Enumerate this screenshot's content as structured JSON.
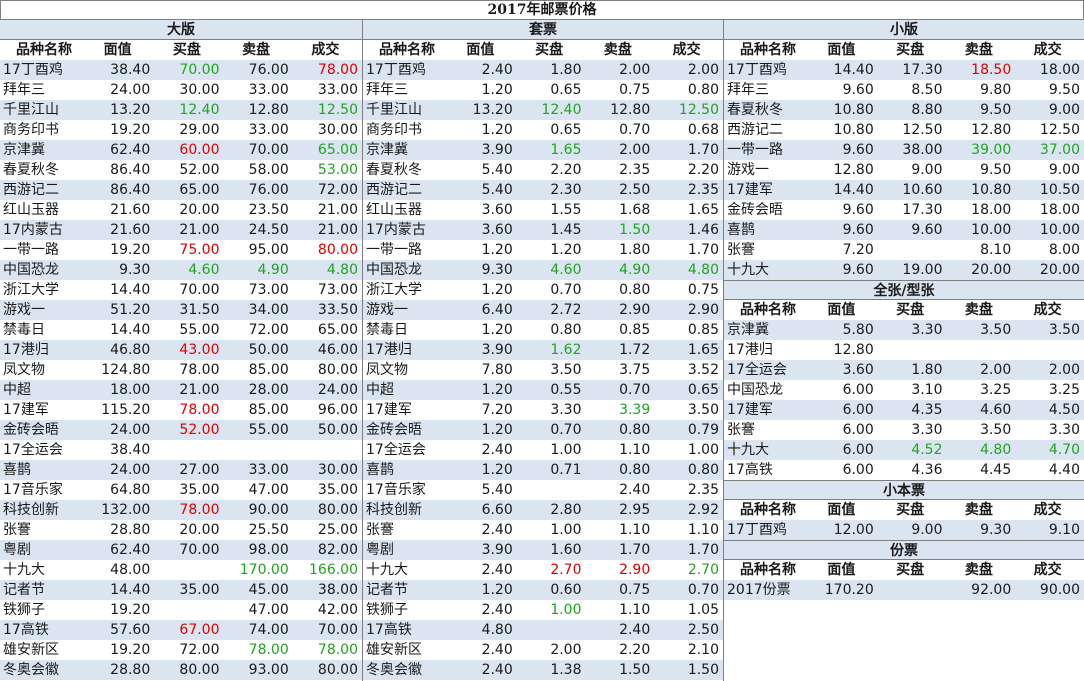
{
  "title": "2017年邮票价格",
  "headers": [
    "品种名称",
    "面值",
    "买盘",
    "卖盘",
    "成交"
  ],
  "sections": {
    "daban": {
      "title": "大版",
      "rows": [
        [
          "17丁酉鸡",
          "38.40",
          "70.00",
          "76.00",
          "78.00"
        ],
        [
          "拜年三",
          "24.00",
          "30.00",
          "33.00",
          "33.00"
        ],
        [
          "千里江山",
          "13.20",
          "12.40",
          "12.80",
          "12.50"
        ],
        [
          "商务印书",
          "19.20",
          "29.00",
          "33.00",
          "30.00"
        ],
        [
          "京津冀",
          "62.40",
          "60.00",
          "70.00",
          "65.00"
        ],
        [
          "春夏秋冬",
          "86.40",
          "52.00",
          "58.00",
          "53.00"
        ],
        [
          "西游记二",
          "86.40",
          "65.00",
          "76.00",
          "72.00"
        ],
        [
          "红山玉器",
          "21.60",
          "20.00",
          "23.50",
          "21.00"
        ],
        [
          "17内蒙古",
          "21.60",
          "21.00",
          "24.50",
          "21.00"
        ],
        [
          "一带一路",
          "19.20",
          "75.00",
          "95.00",
          "80.00"
        ],
        [
          "中国恐龙",
          "9.30",
          "4.60",
          "4.90",
          "4.80"
        ],
        [
          "浙江大学",
          "14.40",
          "70.00",
          "73.00",
          "73.00"
        ],
        [
          "游戏一",
          "51.20",
          "31.50",
          "34.00",
          "33.50"
        ],
        [
          "禁毒日",
          "14.40",
          "55.00",
          "72.00",
          "65.00"
        ],
        [
          "17港归",
          "46.80",
          "43.00",
          "50.00",
          "46.00"
        ],
        [
          "凤文物",
          "124.80",
          "78.00",
          "85.00",
          "80.00"
        ],
        [
          "中超",
          "18.00",
          "21.00",
          "28.00",
          "24.00"
        ],
        [
          "17建军",
          "115.20",
          "78.00",
          "85.00",
          "96.00"
        ],
        [
          "金砖会晤",
          "24.00",
          "52.00",
          "55.00",
          "50.00"
        ],
        [
          "17全运会",
          "38.40",
          "",
          "",
          ""
        ],
        [
          "喜鹊",
          "24.00",
          "27.00",
          "33.00",
          "30.00"
        ],
        [
          "17音乐家",
          "64.80",
          "35.00",
          "47.00",
          "35.00"
        ],
        [
          "科技创新",
          "132.00",
          "78.00",
          "90.00",
          "80.00"
        ],
        [
          "张謇",
          "28.80",
          "20.00",
          "25.50",
          "25.00"
        ],
        [
          "粤剧",
          "62.40",
          "70.00",
          "98.00",
          "82.00"
        ],
        [
          "十九大",
          "48.00",
          "",
          "170.00",
          "166.00"
        ],
        [
          "记者节",
          "14.40",
          "35.00",
          "45.00",
          "38.00"
        ],
        [
          "铁狮子",
          "19.20",
          "",
          "47.00",
          "42.00"
        ],
        [
          "17高铁",
          "57.60",
          "67.00",
          "74.00",
          "70.00"
        ],
        [
          "雄安新区",
          "19.20",
          "72.00",
          "78.00",
          "78.00"
        ],
        [
          "冬奥会徽",
          "28.80",
          "80.00",
          "93.00",
          "80.00"
        ]
      ]
    },
    "taopiao": {
      "title": "套票",
      "rows": [
        [
          "17丁酉鸡",
          "2.40",
          "1.80",
          "2.00",
          "2.00"
        ],
        [
          "拜年三",
          "1.20",
          "0.65",
          "0.75",
          "0.80"
        ],
        [
          "千里江山",
          "13.20",
          "12.40",
          "12.80",
          "12.50"
        ],
        [
          "商务印书",
          "1.20",
          "0.65",
          "0.70",
          "0.68"
        ],
        [
          "京津冀",
          "3.90",
          "1.65",
          "2.00",
          "1.70"
        ],
        [
          "春夏秋冬",
          "5.40",
          "2.20",
          "2.35",
          "2.20"
        ],
        [
          "西游记二",
          "5.40",
          "2.30",
          "2.50",
          "2.35"
        ],
        [
          "红山玉器",
          "3.60",
          "1.55",
          "1.68",
          "1.65"
        ],
        [
          "17内蒙古",
          "3.60",
          "1.45",
          "1.50",
          "1.46"
        ],
        [
          "一带一路",
          "1.20",
          "1.20",
          "1.80",
          "1.70"
        ],
        [
          "中国恐龙",
          "9.30",
          "4.60",
          "4.90",
          "4.80"
        ],
        [
          "浙江大学",
          "1.20",
          "0.70",
          "0.80",
          "0.75"
        ],
        [
          "游戏一",
          "6.40",
          "2.72",
          "2.90",
          "2.90"
        ],
        [
          "禁毒日",
          "1.20",
          "0.80",
          "0.85",
          "0.85"
        ],
        [
          "17港归",
          "3.90",
          "1.62",
          "1.72",
          "1.65"
        ],
        [
          "凤文物",
          "7.80",
          "3.50",
          "3.75",
          "3.52"
        ],
        [
          "中超",
          "1.20",
          "0.55",
          "0.70",
          "0.65"
        ],
        [
          "17建军",
          "7.20",
          "3.30",
          "3.39",
          "3.50"
        ],
        [
          "金砖会晤",
          "1.20",
          "0.70",
          "0.80",
          "0.79"
        ],
        [
          "17全运会",
          "2.40",
          "1.00",
          "1.10",
          "1.00"
        ],
        [
          "喜鹊",
          "1.20",
          "0.71",
          "0.80",
          "0.80"
        ],
        [
          "17音乐家",
          "5.40",
          "",
          "2.40",
          "2.35"
        ],
        [
          "科技创新",
          "6.60",
          "2.80",
          "2.95",
          "2.92"
        ],
        [
          "张謇",
          "2.40",
          "1.00",
          "1.10",
          "1.10"
        ],
        [
          "粤剧",
          "3.90",
          "1.60",
          "1.70",
          "1.70"
        ],
        [
          "十九大",
          "2.40",
          "2.70",
          "2.90",
          "2.70"
        ],
        [
          "记者节",
          "1.20",
          "0.60",
          "0.75",
          "0.70"
        ],
        [
          "铁狮子",
          "2.40",
          "1.00",
          "1.10",
          "1.05"
        ],
        [
          "17高铁",
          "4.80",
          "",
          "2.40",
          "2.50"
        ],
        [
          "雄安新区",
          "2.40",
          "2.00",
          "2.20",
          "2.10"
        ],
        [
          "冬奥会徽",
          "2.40",
          "1.38",
          "1.50",
          "1.50"
        ]
      ]
    },
    "xiaoban": {
      "title": "小版",
      "rows": [
        [
          "17丁酉鸡",
          "14.40",
          "17.30",
          "18.50",
          "18.00"
        ],
        [
          "拜年三",
          "9.60",
          "8.50",
          "9.80",
          "9.50"
        ],
        [
          "春夏秋冬",
          "10.80",
          "8.80",
          "9.50",
          "9.00"
        ],
        [
          "西游记二",
          "10.80",
          "12.50",
          "12.80",
          "12.50"
        ],
        [
          "一带一路",
          "9.60",
          "38.00",
          "39.00",
          "37.00"
        ],
        [
          "游戏一",
          "12.80",
          "9.00",
          "9.50",
          "9.00"
        ],
        [
          "17建军",
          "14.40",
          "10.60",
          "10.80",
          "10.50"
        ],
        [
          "金砖会晤",
          "9.60",
          "17.30",
          "18.00",
          "18.00"
        ],
        [
          "喜鹊",
          "9.60",
          "9.60",
          "10.00",
          "10.00"
        ],
        [
          "张謇",
          "7.20",
          "",
          "8.10",
          "8.00"
        ],
        [
          "十九大",
          "9.60",
          "19.00",
          "20.00",
          "20.00"
        ]
      ]
    },
    "quanzhang": {
      "title": "全张/型张",
      "rows": [
        [
          "京津冀",
          "5.80",
          "3.30",
          "3.50",
          "3.50"
        ],
        [
          "17港归",
          "12.80",
          "",
          "",
          ""
        ],
        [
          "17全运会",
          "3.60",
          "1.80",
          "2.00",
          "2.00"
        ],
        [
          "中国恐龙",
          "6.00",
          "3.10",
          "3.25",
          "3.25"
        ],
        [
          "17建军",
          "6.00",
          "4.35",
          "4.60",
          "4.50"
        ],
        [
          "张謇",
          "6.00",
          "3.30",
          "3.50",
          "3.30"
        ],
        [
          "十九大",
          "6.00",
          "4.52",
          "4.80",
          "4.70"
        ],
        [
          "17高铁",
          "6.00",
          "4.36",
          "4.45",
          "4.40"
        ]
      ]
    },
    "xiaobenpiao": {
      "title": "小本票",
      "rows": [
        [
          "17丁酉鸡",
          "12.00",
          "9.00",
          "9.30",
          "9.10"
        ]
      ]
    },
    "fenpiao": {
      "title": "份票",
      "rows": [
        [
          "2017份票",
          "170.20",
          "",
          "92.00",
          "90.00"
        ]
      ]
    }
  },
  "colors": {
    "up": "#e00000",
    "down": "#1fa51f",
    "stripe": "#dbe5f1"
  },
  "highlights": {
    "daban": [
      [
        0,
        2,
        "down"
      ],
      [
        0,
        4,
        "up"
      ],
      [
        2,
        2,
        "down"
      ],
      [
        2,
        4,
        "down"
      ],
      [
        4,
        2,
        "up"
      ],
      [
        4,
        4,
        "down"
      ],
      [
        5,
        4,
        "down"
      ],
      [
        9,
        2,
        "up"
      ],
      [
        9,
        4,
        "up"
      ],
      [
        10,
        2,
        "down"
      ],
      [
        10,
        3,
        "down"
      ],
      [
        10,
        4,
        "down"
      ],
      [
        14,
        2,
        "up"
      ],
      [
        17,
        2,
        "up"
      ],
      [
        18,
        2,
        "up"
      ],
      [
        22,
        2,
        "up"
      ],
      [
        25,
        3,
        "down"
      ],
      [
        25,
        4,
        "down"
      ],
      [
        28,
        2,
        "up"
      ],
      [
        29,
        3,
        "down"
      ],
      [
        29,
        4,
        "down"
      ]
    ],
    "taopiao": [
      [
        2,
        2,
        "down"
      ],
      [
        2,
        4,
        "down"
      ],
      [
        4,
        2,
        "down"
      ],
      [
        8,
        3,
        "down"
      ],
      [
        10,
        2,
        "down"
      ],
      [
        10,
        3,
        "down"
      ],
      [
        10,
        4,
        "down"
      ],
      [
        14,
        2,
        "down"
      ],
      [
        17,
        3,
        "down"
      ],
      [
        25,
        2,
        "up"
      ],
      [
        25,
        3,
        "up"
      ],
      [
        25,
        4,
        "down"
      ],
      [
        27,
        2,
        "down"
      ]
    ],
    "xiaoban": [
      [
        0,
        3,
        "up"
      ],
      [
        4,
        3,
        "down"
      ],
      [
        4,
        4,
        "down"
      ]
    ],
    "quanzhang": [
      [
        6,
        2,
        "down"
      ],
      [
        6,
        3,
        "down"
      ],
      [
        6,
        4,
        "down"
      ]
    ],
    "xiaobenpiao": [],
    "fenpiao": []
  }
}
